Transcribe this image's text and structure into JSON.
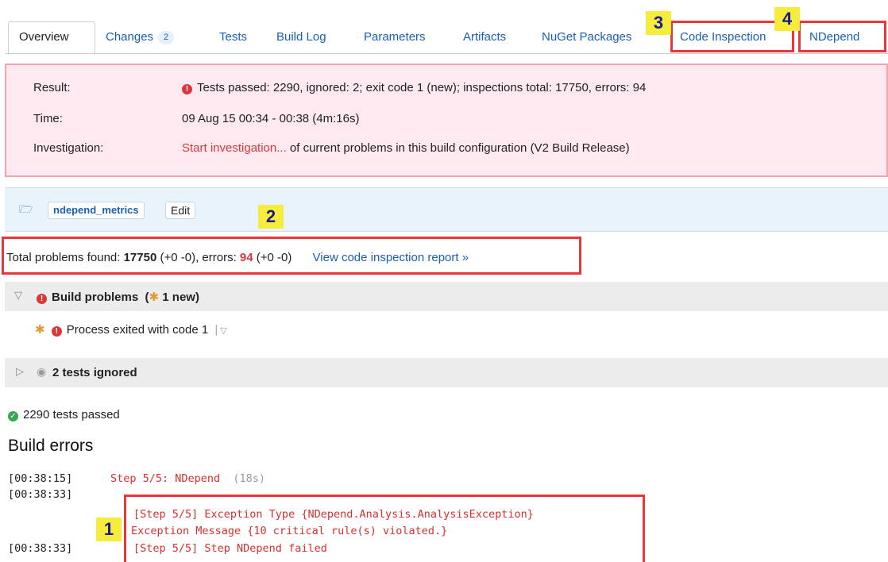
{
  "tabs": {
    "overview": "Overview",
    "changes": "Changes",
    "changes_count": "2",
    "tests": "Tests",
    "build_log": "Build Log",
    "parameters": "Parameters",
    "artifacts": "Artifacts",
    "nuget": "NuGet Packages",
    "code_inspection": "Code Inspection",
    "ndepend": "NDepend"
  },
  "callouts": {
    "one": "1",
    "two": "2",
    "three": "3",
    "four": "4"
  },
  "result": {
    "result_label": "Result:",
    "result_value": "Tests passed: 2290, ignored: 2; exit code 1 (new); inspections total: 17750, errors: 94",
    "time_label": "Time:",
    "time_value": "09 Aug 15 00:34 - 00:38 (4m:16s)",
    "investigation_label": "Investigation:",
    "investigation_link": "Start investigation...",
    "investigation_text": "of current problems in this build configuration (V2 Build Release)"
  },
  "artifact": {
    "tag": "ndepend_metrics",
    "edit": "Edit"
  },
  "summary": {
    "prefix": "Total problems found: ",
    "total": "17750",
    "total_delta": " (+0 -0), errors: ",
    "errors": "94",
    "errors_delta": " (+0 -0)",
    "report_link": "View code inspection report »"
  },
  "build_problems": {
    "title": "Build problems",
    "new_count": "1 new",
    "item": "Process exited with code 1"
  },
  "ignored": {
    "title": "2 tests ignored"
  },
  "passed": {
    "text": "2290 tests passed"
  },
  "build_errors": {
    "heading": "Build errors",
    "lines": [
      {
        "time": "[00:38:15]",
        "text": "Step 5/5: NDepend",
        "extra": "(18s)"
      },
      {
        "time": "[00:38:33]",
        "text": ""
      },
      {
        "time": "",
        "text": "[Step 5/5] Exception Type {NDepend.Analysis.AnalysisException}"
      },
      {
        "time": "",
        "text": "Exception Message {10 critical rule(s) violated.}"
      },
      {
        "time": "[00:38:33]",
        "text": "[Step 5/5] Step NDepend failed"
      }
    ]
  },
  "colors": {
    "accent_red": "#e8373b",
    "link_blue": "#1b5fb5",
    "callout_yellow": "#f5ec3c"
  }
}
